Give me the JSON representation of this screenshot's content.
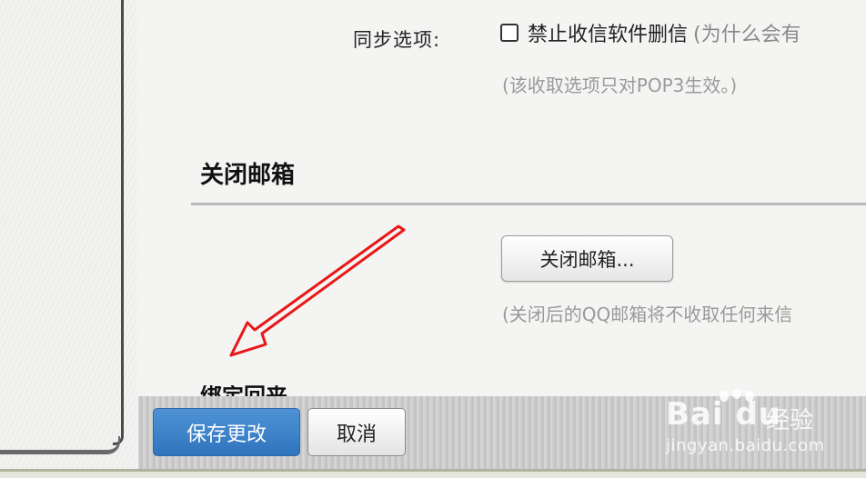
{
  "sync": {
    "label": "同步选项:",
    "checkbox_label": "禁止收信软件删信",
    "checkbox_note": "(为什么会有",
    "hint": "(该收取选项只对POP3生效。)"
  },
  "close_section": {
    "title": "关闭邮箱",
    "button": "关闭邮箱...",
    "hint": "(关闭后的QQ邮箱将不收取任何来信"
  },
  "next_section": {
    "title_partial": "绑定回来"
  },
  "footer": {
    "save": "保存更改",
    "cancel": "取消"
  },
  "watermark": {
    "logo": "Bai du",
    "cn": "经验",
    "url": "jingyan.baidu.com"
  },
  "colors": {
    "save_button": "#3a80c8",
    "arrow": "#e81818"
  }
}
